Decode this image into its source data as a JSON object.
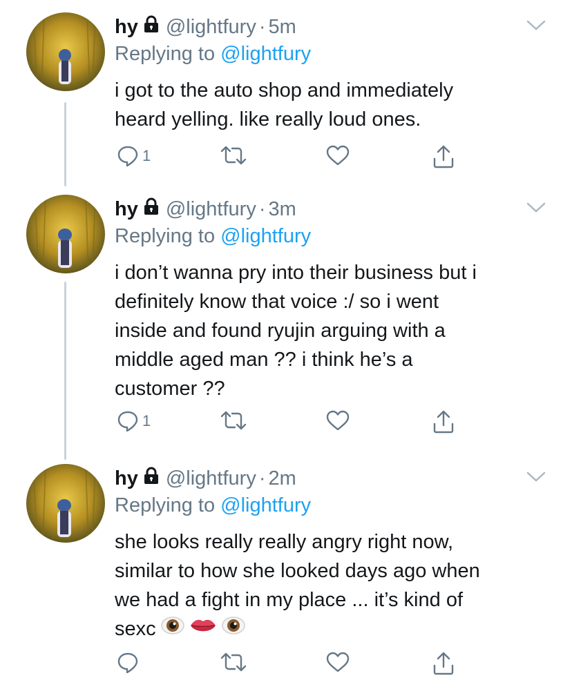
{
  "tweets": [
    {
      "name": "hy",
      "handle": "@lightfury",
      "dot": "·",
      "time": "5m",
      "replying_prefix": "Replying to",
      "replying_to": "@lightfury",
      "text": "i got to the auto shop and immediately\nheard yelling. like really loud ones.",
      "reply_count": "1"
    },
    {
      "name": "hy",
      "handle": "@lightfury",
      "dot": "·",
      "time": "3m",
      "replying_prefix": "Replying to",
      "replying_to": "@lightfury",
      "text": "i don’t wanna pry into their business but i\ndefinitely know that voice :/ so i went\ninside and found ryujin arguing with a\nmiddle aged man ?? i think he’s a\ncustomer ??",
      "reply_count": "1"
    },
    {
      "name": "hy",
      "handle": "@lightfury",
      "dot": "·",
      "time": "2m",
      "replying_prefix": "Replying to",
      "replying_to": "@lightfury",
      "text": "she looks really really angry right now,\nsimilar to how she looked days ago when\nwe had a fight in my place ... it’s kind of\nsexc",
      "emojis": [
        "eye-emoji",
        "lips-emoji",
        "eye-emoji"
      ]
    }
  ],
  "colors": {
    "text": "#14171a",
    "secondary": "#657786",
    "link": "#1da1f2",
    "thread_line": "#c9d2d9"
  },
  "icons": [
    "lock-icon",
    "chevron-down-icon",
    "reply-icon",
    "retweet-icon",
    "like-icon",
    "share-icon"
  ]
}
